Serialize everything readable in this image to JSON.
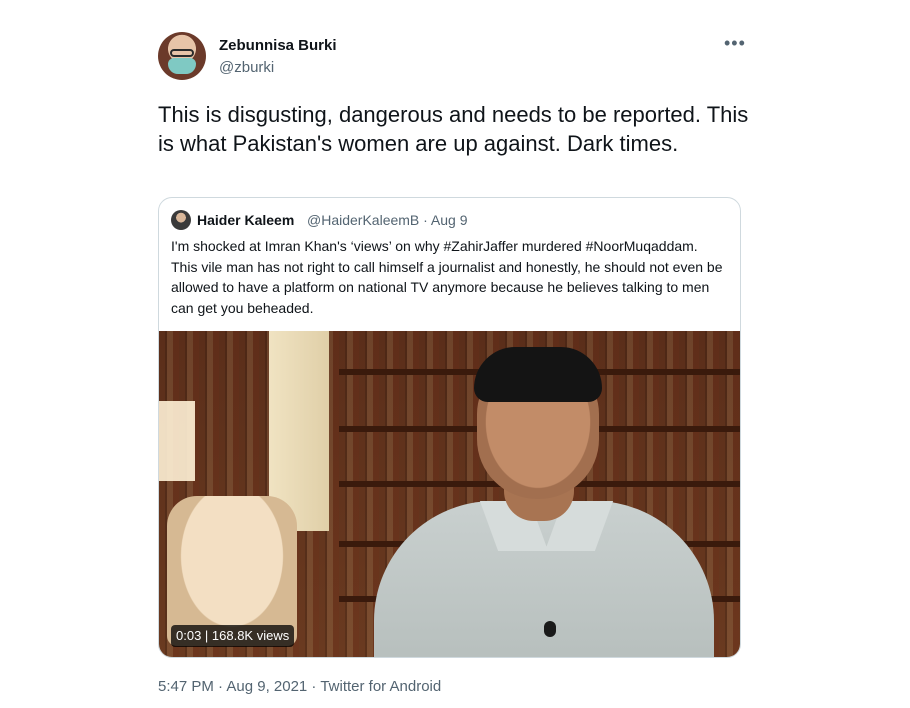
{
  "author": {
    "name": "Zebunnisa Burki",
    "handle": "@zburki"
  },
  "more_icon": "•••",
  "tweet_text": "This is disgusting, dangerous and needs to be reported. This is what Pakistan's women are up against. Dark times.",
  "quoted": {
    "name": "Haider Kaleem",
    "meta": "@HaiderKaleemB · Aug 9",
    "text": "I'm shocked at Imran Khan's ‘views’ on why #ZahirJaffer murdered #NoorMuqaddam. This vile man has not right to call himself a journalist and honestly, he should not even be allowed to have a platform on national TV anymore because he believes talking to men can get you beheaded."
  },
  "video": {
    "overlay": "0:03 | 168.8K views"
  },
  "footer": "5:47 PM · Aug 9, 2021 · Twitter for Android",
  "icons": {
    "more": "more-options-icon"
  },
  "colors": {
    "text_primary": "#0f1419",
    "text_secondary": "#536471",
    "border": "#cfd9de"
  }
}
